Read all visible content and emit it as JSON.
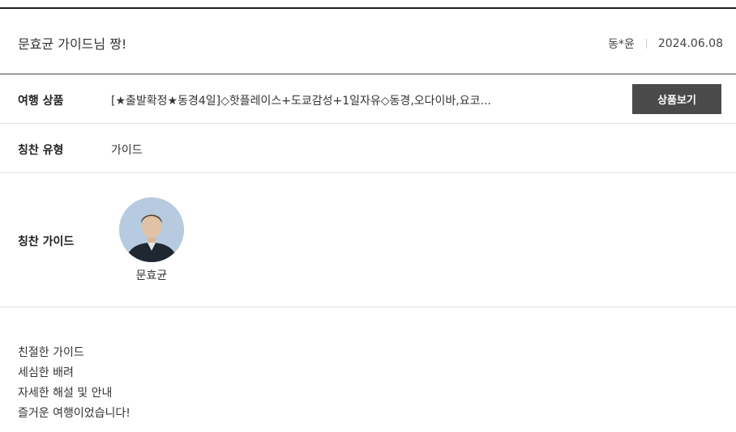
{
  "review": {
    "title": "문효균 가이드님 짱!",
    "author": "동*윤",
    "date": "2024.06.08"
  },
  "product": {
    "label": "여행 상품",
    "value": "[★출발확정★동경4일]◇핫플레이스+도쿄감성+1일자유◇동경,오다이바,요코...",
    "button_label": "상품보기"
  },
  "praise_type": {
    "label": "칭찬 유형",
    "value": "가이드"
  },
  "praise_guide": {
    "label": "칭찬 가이드",
    "name": "문효균"
  },
  "body": {
    "lines": [
      "친절한 가이드",
      "세심한 배려",
      "자세한 해설 및 안내",
      "즐거운 여행이었습니다!"
    ]
  }
}
